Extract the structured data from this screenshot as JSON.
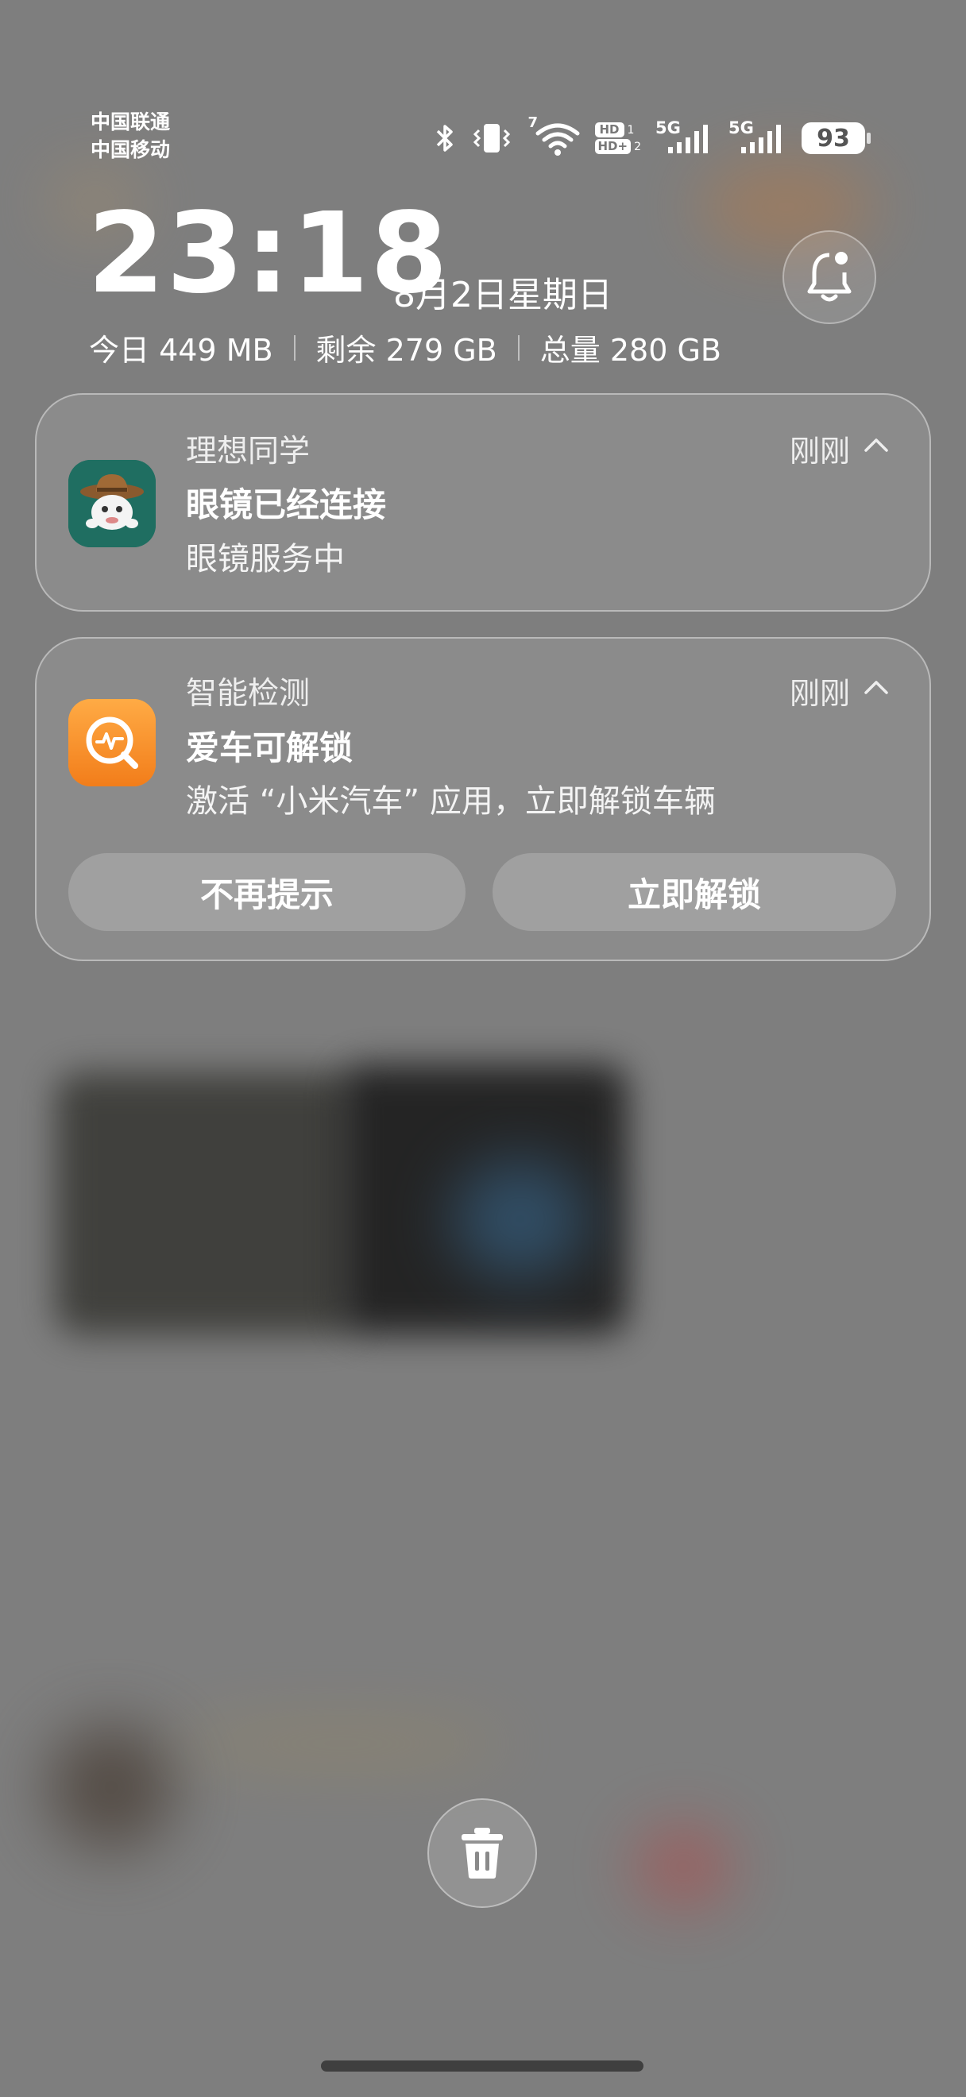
{
  "status_bar": {
    "carrier_1": "中国联通",
    "carrier_2": "中国移动",
    "wifi_badge": "7",
    "sim1_hd": "HD",
    "sim1_index": "1",
    "sim2_hd": "HD+",
    "sim2_index": "2",
    "net1": "5G",
    "net2": "5G",
    "battery": "93",
    "icons": [
      "bluetooth-icon",
      "vibrate-icon",
      "wifi-icon",
      "signal-icon",
      "signal-icon",
      "battery-icon"
    ]
  },
  "clock": {
    "time": "23:18",
    "date": "8月2日星期日"
  },
  "storage": {
    "today": "今日 449 MB",
    "remaining": "剩余 279 GB",
    "total": "总量 280 GB"
  },
  "notifications": [
    {
      "app": "理想同学",
      "time": "刚刚",
      "title": "眼镜已经连接",
      "body": "眼镜服务中",
      "icon": "cowboy-mascot-icon",
      "icon_bg": "#1f6e61"
    },
    {
      "app": "智能检测",
      "time": "刚刚",
      "title": "爱车可解锁",
      "body": "激活 “小米汽车” 应用，立即解锁车辆",
      "icon": "diagnostics-icon",
      "icon_bg": "#f6952a",
      "actions": [
        "不再提示",
        "立即解锁"
      ]
    }
  ],
  "colors": {
    "accent_orange": "#f6952a",
    "accent_green": "#1f6e61"
  }
}
